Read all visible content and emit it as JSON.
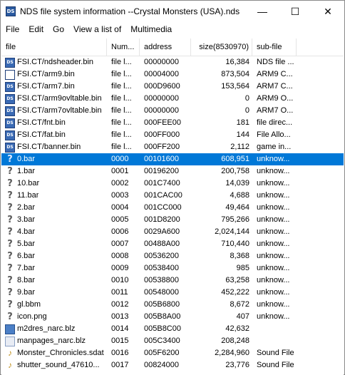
{
  "window": {
    "title": "NDS file system information --Crystal Monsters (USA).nds",
    "controls": {
      "minimize": "—",
      "maximize": "☐",
      "close": "✕"
    }
  },
  "menu": [
    "File",
    "Edit",
    "Go",
    "View a list of",
    "Multimedia"
  ],
  "columns": [
    "file",
    "Num...",
    "address",
    "size(8530970)",
    "sub-file"
  ],
  "rows": [
    {
      "icon": "ds-icon",
      "file": "FSI.CT/ndsheader.bin",
      "num": "file l...",
      "address": "00000000",
      "size": "16,384",
      "sub": "NDS file ..."
    },
    {
      "icon": "arm9-icon",
      "file": "FSI.CT/arm9.bin",
      "num": "file l...",
      "address": "00004000",
      "size": "873,504",
      "sub": "ARM9 C..."
    },
    {
      "icon": "ds-icon",
      "file": "FSI.CT/arm7.bin",
      "num": "file l...",
      "address": "000D9600",
      "size": "153,564",
      "sub": "ARM7 C..."
    },
    {
      "icon": "ds-icon",
      "file": "FSI.CT/arm9ovltable.bin",
      "num": "file l...",
      "address": "00000000",
      "size": "0",
      "sub": "ARM9 O..."
    },
    {
      "icon": "ds-icon",
      "file": "FSI.CT/arm7ovltable.bin",
      "num": "file l...",
      "address": "00000000",
      "size": "0",
      "sub": "ARM7 O..."
    },
    {
      "icon": "ds-icon",
      "file": "FSI.CT/fnt.bin",
      "num": "file l...",
      "address": "000FEE00",
      "size": "181",
      "sub": "file direc..."
    },
    {
      "icon": "ds-icon",
      "file": "FSI.CT/fat.bin",
      "num": "file l...",
      "address": "000FF000",
      "size": "144",
      "sub": "File Allo..."
    },
    {
      "icon": "ds-icon",
      "file": "FSI.CT/banner.bin",
      "num": "file l...",
      "address": "000FF200",
      "size": "2,112",
      "sub": "game in..."
    },
    {
      "icon": "unknown-icon",
      "file": "0.bar",
      "num": "0000",
      "address": "00101600",
      "size": "608,951",
      "sub": "unknow...",
      "selected": true
    },
    {
      "icon": "unknown-icon",
      "file": "1.bar",
      "num": "0001",
      "address": "00196200",
      "size": "200,758",
      "sub": "unknow..."
    },
    {
      "icon": "unknown-icon",
      "file": "10.bar",
      "num": "0002",
      "address": "001C7400",
      "size": "14,039",
      "sub": "unknow..."
    },
    {
      "icon": "unknown-icon",
      "file": "11.bar",
      "num": "0003",
      "address": "001CAC00",
      "size": "4,688",
      "sub": "unknow..."
    },
    {
      "icon": "unknown-icon",
      "file": "2.bar",
      "num": "0004",
      "address": "001CC000",
      "size": "49,464",
      "sub": "unknow..."
    },
    {
      "icon": "unknown-icon",
      "file": "3.bar",
      "num": "0005",
      "address": "001D8200",
      "size": "795,266",
      "sub": "unknow..."
    },
    {
      "icon": "unknown-icon",
      "file": "4.bar",
      "num": "0006",
      "address": "0029A600",
      "size": "2,024,144",
      "sub": "unknow..."
    },
    {
      "icon": "unknown-icon",
      "file": "5.bar",
      "num": "0007",
      "address": "00488A00",
      "size": "710,440",
      "sub": "unknow..."
    },
    {
      "icon": "unknown-icon",
      "file": "6.bar",
      "num": "0008",
      "address": "00536200",
      "size": "8,368",
      "sub": "unknow..."
    },
    {
      "icon": "unknown-icon",
      "file": "7.bar",
      "num": "0009",
      "address": "00538400",
      "size": "985",
      "sub": "unknow..."
    },
    {
      "icon": "unknown-icon",
      "file": "8.bar",
      "num": "0010",
      "address": "00538800",
      "size": "63,258",
      "sub": "unknow..."
    },
    {
      "icon": "unknown-icon",
      "file": "9.bar",
      "num": "0011",
      "address": "00548000",
      "size": "452,222",
      "sub": "unknow..."
    },
    {
      "icon": "unknown-icon",
      "file": "gl.bbm",
      "num": "0012",
      "address": "005B6800",
      "size": "8,672",
      "sub": "unknow..."
    },
    {
      "icon": "unknown-icon",
      "file": "icon.png",
      "num": "0013",
      "address": "005B8A00",
      "size": "407",
      "sub": "unknow..."
    },
    {
      "icon": "image-icon",
      "file": "m2dres_narc.blz",
      "num": "0014",
      "address": "005B8C00",
      "size": "42,632",
      "sub": ""
    },
    {
      "icon": "archive-icon",
      "file": "manpages_narc.blz",
      "num": "0015",
      "address": "005C3400",
      "size": "208,248",
      "sub": ""
    },
    {
      "icon": "sound-icon",
      "file": "Monster_Chronicles.sdat",
      "num": "0016",
      "address": "005F6200",
      "size": "2,284,960",
      "sub": "Sound File"
    },
    {
      "icon": "sound-icon",
      "file": "shutter_sound_47610...",
      "num": "0017",
      "address": "00824000",
      "size": "23,776",
      "sub": "Sound File"
    }
  ]
}
